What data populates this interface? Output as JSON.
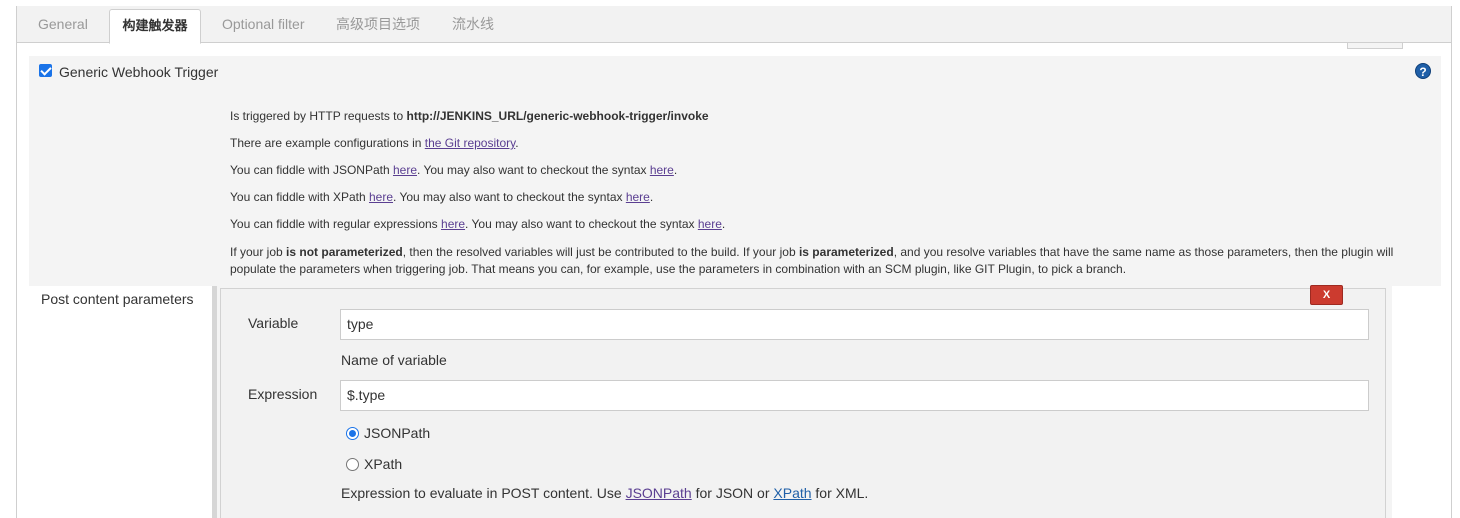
{
  "tabs": [
    {
      "label": "General"
    },
    {
      "label": "构建触发器"
    },
    {
      "label": "Optional filter"
    },
    {
      "label": "高级项目选项"
    },
    {
      "label": "流水线"
    }
  ],
  "trigger": {
    "checked": true,
    "label": "Generic Webhook Trigger",
    "help_icon": "?"
  },
  "info": {
    "line1_prefix": "Is triggered by HTTP requests to ",
    "line1_url": "http://JENKINS_URL/generic-webhook-trigger/invoke",
    "line2_prefix": "There are example configurations in ",
    "line2_link": "the Git repository",
    "line2_suffix": ".",
    "line3_a": "You can fiddle with JSONPath ",
    "line3_link1": "here",
    "line3_b": ". You may also want to checkout the syntax ",
    "line3_link2": "here",
    "line3_c": ".",
    "line4_a": "You can fiddle with XPath ",
    "line4_link1": "here",
    "line4_b": ". You may also want to checkout the syntax ",
    "line4_link2": "here",
    "line4_c": ".",
    "line5_a": "You can fiddle with regular expressions ",
    "line5_link1": "here",
    "line5_b": ". You may also want to checkout the syntax ",
    "line5_link2": "here",
    "line5_c": ".",
    "line6_a": "If your job ",
    "line6_b1": "is not parameterized",
    "line6_c": ", then the resolved variables will just be contributed to the build. If your job ",
    "line6_b2": "is parameterized",
    "line6_d": ", and you resolve variables that have the same name as those parameters, then the plugin will populate the parameters when triggering job. That means you can, for example, use the parameters in combination with an SCM plugin, like GIT Plugin, to pick a branch."
  },
  "post_content": {
    "section_label": "Post content parameters",
    "delete_label": "X",
    "variable_label": "Variable",
    "variable_value": "type",
    "variable_hint": "Name of variable",
    "expression_label": "Expression",
    "expression_value": "$.type",
    "options": [
      {
        "label": "JSONPath",
        "selected": true
      },
      {
        "label": "XPath",
        "selected": false
      }
    ],
    "desc_a": "Expression to evaluate in POST content. Use ",
    "desc_link1": "JSONPath",
    "desc_b": " for JSON or ",
    "desc_link2": "XPath",
    "desc_c": " for XML."
  }
}
